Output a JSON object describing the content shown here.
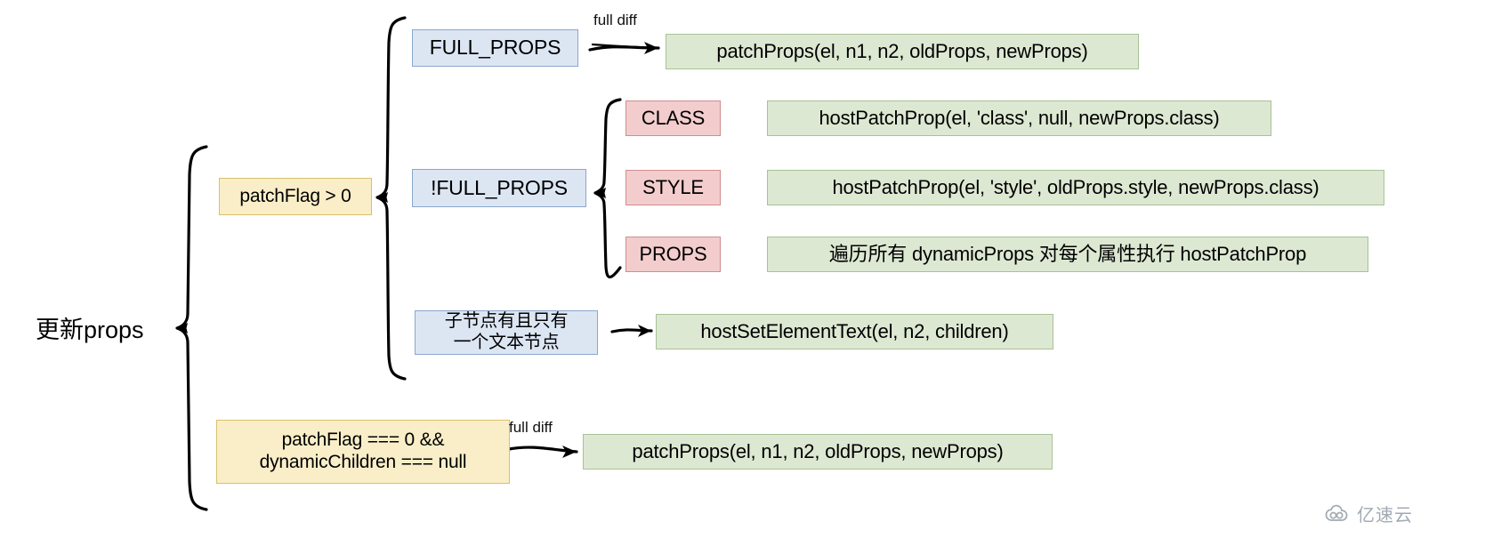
{
  "diagram": {
    "root": {
      "label": "更新props"
    },
    "branches": {
      "patch_flag_positive": {
        "label": "patchFlag > 0"
      },
      "patch_flag_zero": {
        "label": "patchFlag === 0  &&\ndynamicChildren === null"
      }
    },
    "nodes": {
      "full_props": {
        "label": "FULL_PROPS"
      },
      "not_full_props": {
        "label": "!FULL_PROPS"
      },
      "class_flag": {
        "label": "CLASS"
      },
      "style_flag": {
        "label": "STYLE"
      },
      "props_flag": {
        "label": "PROPS"
      },
      "single_text_child": {
        "label": "子节点有且只有\n一个文本节点"
      }
    },
    "actions": {
      "patch_props_full": {
        "label": "patchProps(el, n1, n2, oldProps, newProps)"
      },
      "host_patch_prop_class": {
        "label": "hostPatchProp(el, 'class', null, newProps.class)"
      },
      "host_patch_prop_style": {
        "label": "hostPatchProp(el, 'style', oldProps.style, newProps.class)"
      },
      "host_patch_prop_props": {
        "label": "遍历所有 dynamicProps 对每个属性执行 hostPatchProp"
      },
      "host_set_element_text": {
        "label": "hostSetElementText(el, n2, children)"
      },
      "patch_props_full_bottom": {
        "label": "patchProps(el, n1, n2, oldProps, newProps)"
      }
    },
    "edge_labels": {
      "full_diff_top": "full diff",
      "full_diff_bottom": "full diff"
    },
    "colors": {
      "blue_fill": "#dce6f3",
      "blue_border": "#8ba7cc",
      "yellow_fill": "#faeec8",
      "yellow_border": "#d8c06a",
      "red_fill": "#f3cdcd",
      "red_border": "#cf8d8d",
      "green_fill": "#dde8d3",
      "green_border": "#a8c295",
      "stroke": "#000000"
    }
  },
  "watermark": {
    "text": "亿速云",
    "icon": "cloud-icon"
  }
}
